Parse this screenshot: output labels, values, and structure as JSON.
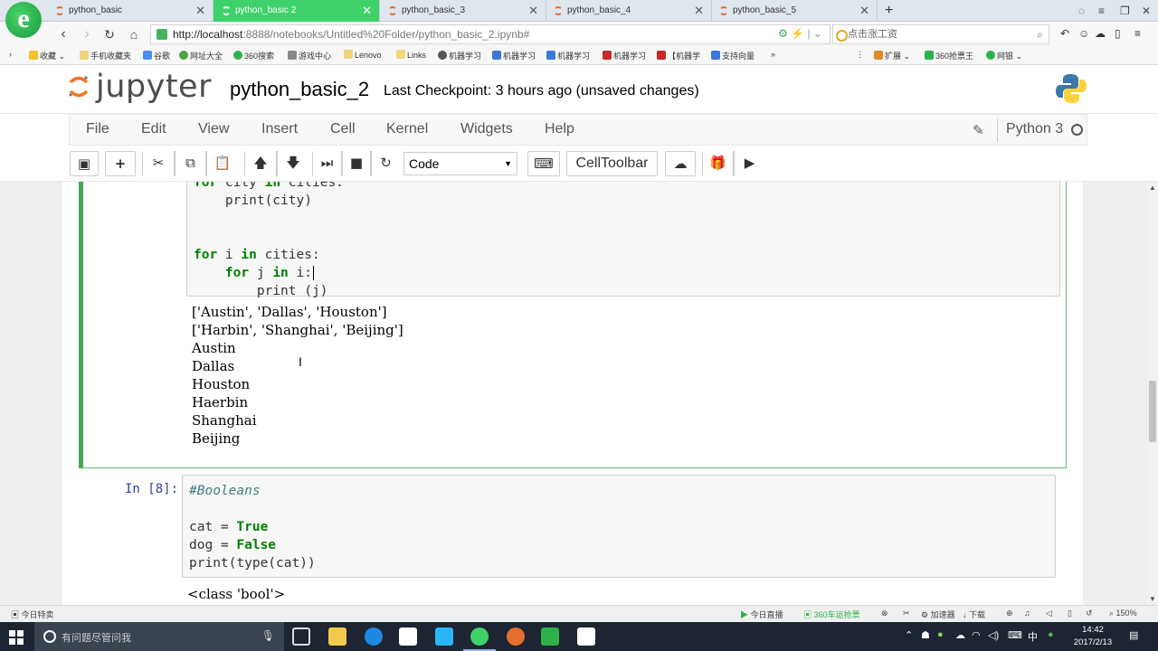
{
  "browser": {
    "logo": "e",
    "tabs": [
      {
        "title": "python_basic",
        "active": false
      },
      {
        "title": "python_basic 2",
        "active": true
      },
      {
        "title": "python_basic_3",
        "active": false
      },
      {
        "title": "python_basic_4",
        "active": false
      },
      {
        "title": "python_basic_5",
        "active": false
      }
    ],
    "new_tab": "+",
    "url_host": "http://localhost",
    "url_path": ":8888/notebooks/Untitled%20Folder/python_basic_2.ipynb#",
    "search_placeholder": "点击涨工资",
    "bookmarks": [
      "收藏",
      "手机收藏夹",
      "谷歌",
      "网址大全",
      "360搜索",
      "游戏中心",
      "Lenovo",
      "Links",
      "机器学习",
      "机器学习",
      "机器学习",
      "机器学习",
      "【机器学",
      "支持向量"
    ],
    "bookmarks_more": "»",
    "bookmarks_right": [
      "扩展",
      "360抢票王",
      "网银"
    ]
  },
  "jupyter": {
    "logo_text": "jupyter",
    "notebook_name": "python_basic_2",
    "checkpoint": "Last Checkpoint: 3 hours ago (unsaved changes)",
    "menu": [
      "File",
      "Edit",
      "View",
      "Insert",
      "Cell",
      "Kernel",
      "Widgets",
      "Help"
    ],
    "kernel_name": "Python 3",
    "cell_type": "Code",
    "celltoolbar_label": "CellToolbar"
  },
  "cells": {
    "prev_code_lines": [
      "for city in cities:",
      "    print(city)",
      "",
      "",
      "for i in cities:",
      "    for j in i:",
      "        print (j)"
    ],
    "prev_output": [
      "['Austin', 'Dallas', 'Houston']",
      "['Harbin', 'Shanghai', 'Beijing']",
      "Austin",
      "Dallas",
      "Houston",
      "Haerbin",
      "Shanghai",
      "Beijing"
    ],
    "bool_prompt": "In [8]:",
    "bool_comment": "#Booleans",
    "bool_output": "<class 'bool'>"
  },
  "statusbar": {
    "left": "今日特卖",
    "live": "今日直播",
    "ticket": "360车运抢票",
    "accelerator": "加速器",
    "download": "下载",
    "zoom": "150%"
  },
  "taskbar": {
    "search_placeholder": "有问题尽管问我",
    "ime": "中",
    "time": "14:42",
    "date": "2017/2/13"
  },
  "colors": {
    "tab_active": "#3fd16a",
    "cell_selected_border": "#42a84b",
    "keyword": "#008000",
    "prompt": "#303f9f",
    "taskbar": "#1c2531"
  }
}
